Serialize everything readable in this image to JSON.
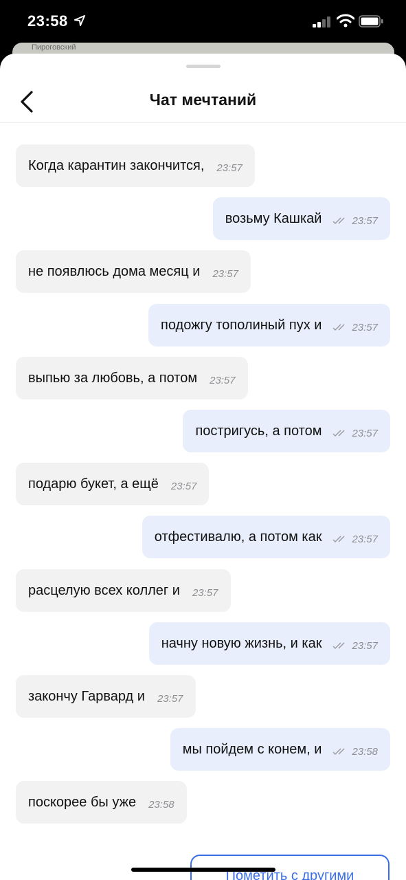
{
  "status_bar": {
    "time": "23:58"
  },
  "map": {
    "label": "Пироговский"
  },
  "header": {
    "title": "Чат мечтаний"
  },
  "messages": [
    {
      "side": "in",
      "text": "Когда карантин закончится,",
      "time": "23:57"
    },
    {
      "side": "out",
      "text": "возьму Кашкай",
      "time": "23:57"
    },
    {
      "side": "in",
      "text": "не появлюсь дома месяц и",
      "time": "23:57"
    },
    {
      "side": "out",
      "text": "подожгу тополиный пух и",
      "time": "23:57"
    },
    {
      "side": "in",
      "text": "выпью за любовь, а потом",
      "time": "23:57"
    },
    {
      "side": "out",
      "text": "постригусь, а потом",
      "time": "23:57"
    },
    {
      "side": "in",
      "text": "подарю букет, а ещё",
      "time": "23:57"
    },
    {
      "side": "out",
      "text": "отфестивалю, а потом как",
      "time": "23:57"
    },
    {
      "side": "in",
      "text": "расцелую всех коллег и",
      "time": "23:57"
    },
    {
      "side": "out",
      "text": "начну новую жизнь, и как",
      "time": "23:57"
    },
    {
      "side": "in",
      "text": "закончу Гарвард и",
      "time": "23:57"
    },
    {
      "side": "out",
      "text": "мы пойдем с конем, и",
      "time": "23:58"
    },
    {
      "side": "in",
      "text": "поскорее бы уже",
      "time": "23:58"
    }
  ],
  "share_button": {
    "label": "Пометить с другими"
  },
  "colors": {
    "accent": "#3a6ee8",
    "incoming_bubble": "#f2f2f2",
    "outgoing_bubble": "#e8eefc"
  },
  "icons": {
    "back": "chevron-left-icon",
    "read_receipt": "double-check-icon"
  }
}
